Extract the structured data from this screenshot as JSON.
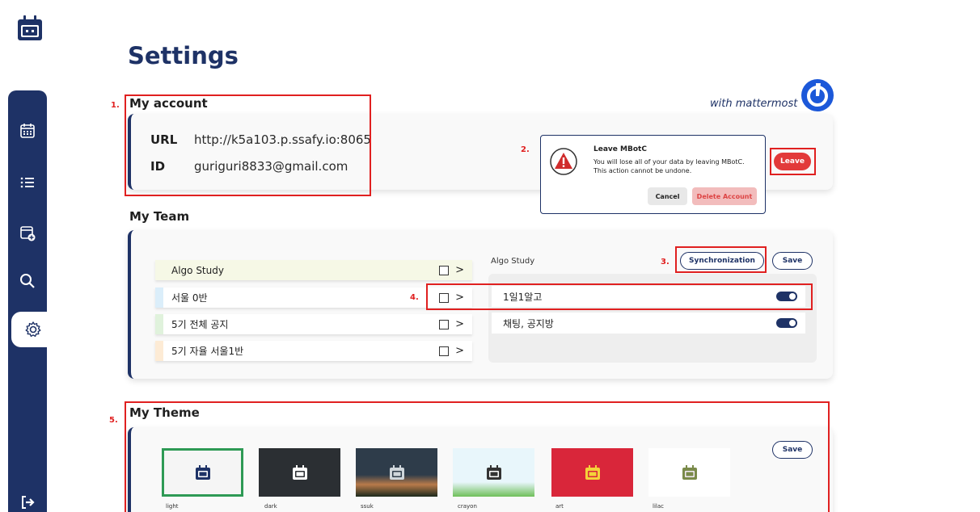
{
  "page": {
    "title": "Settings"
  },
  "sidebar": {
    "items": [
      {
        "name": "calendar-icon"
      },
      {
        "name": "list-icon"
      },
      {
        "name": "add-calendar-icon"
      },
      {
        "name": "search-icon"
      },
      {
        "name": "gear-icon",
        "active": true
      },
      {
        "name": "logout-icon"
      }
    ]
  },
  "annotations": {
    "n1": "1.",
    "n2": "2.",
    "n3": "3.",
    "n4": "4.",
    "n5": "5."
  },
  "account": {
    "title": "My account",
    "url_label": "URL",
    "url_value": "http://k5a103.p.ssafy.io:8065",
    "id_label": "ID",
    "id_value": "guriguri8833@gmail.com",
    "with_text": "with mattermost",
    "leave_label": "Leave"
  },
  "modal": {
    "title": "Leave MBotC",
    "message_line1": "You will lose all of your data by leaving MBotC.",
    "message_line2": "This action cannot be undone.",
    "cancel_label": "Cancel",
    "delete_label": "Delete Account"
  },
  "team": {
    "title": "My Team",
    "teams": [
      {
        "name": "Algo Study",
        "color": "#f3f7d9"
      },
      {
        "name": "서울 0반",
        "color": "#dbeefa"
      },
      {
        "name": "5기 전체 공지",
        "color": "#e0f2dc"
      },
      {
        "name": "5기 자율 서울1반",
        "color": "#fdebd5"
      }
    ],
    "chevron": ">",
    "selected_team": "Algo Study",
    "sync_label": "Synchronization",
    "save_label": "Save",
    "channels": [
      {
        "name": "1일1알고",
        "enabled": true
      },
      {
        "name": "채팅, 공지방",
        "enabled": true
      }
    ]
  },
  "theme": {
    "title": "My Theme",
    "save_label": "Save",
    "themes": [
      {
        "name": "light",
        "bg": "#f5f5f5",
        "selected": true
      },
      {
        "name": "dark",
        "bg": "#2b2f33"
      },
      {
        "name": "ssuk",
        "bg": "#2e3c4a"
      },
      {
        "name": "crayon",
        "bg": "#e8f6fb"
      },
      {
        "name": "art",
        "bg": "#d9263a"
      },
      {
        "name": "lilac",
        "bg": "#ffffff"
      }
    ]
  },
  "colors": {
    "navy": "#1e3266",
    "annotation_red": "#e02020",
    "leave_red": "#e23a3a",
    "selected_green": "#2e9a55"
  }
}
